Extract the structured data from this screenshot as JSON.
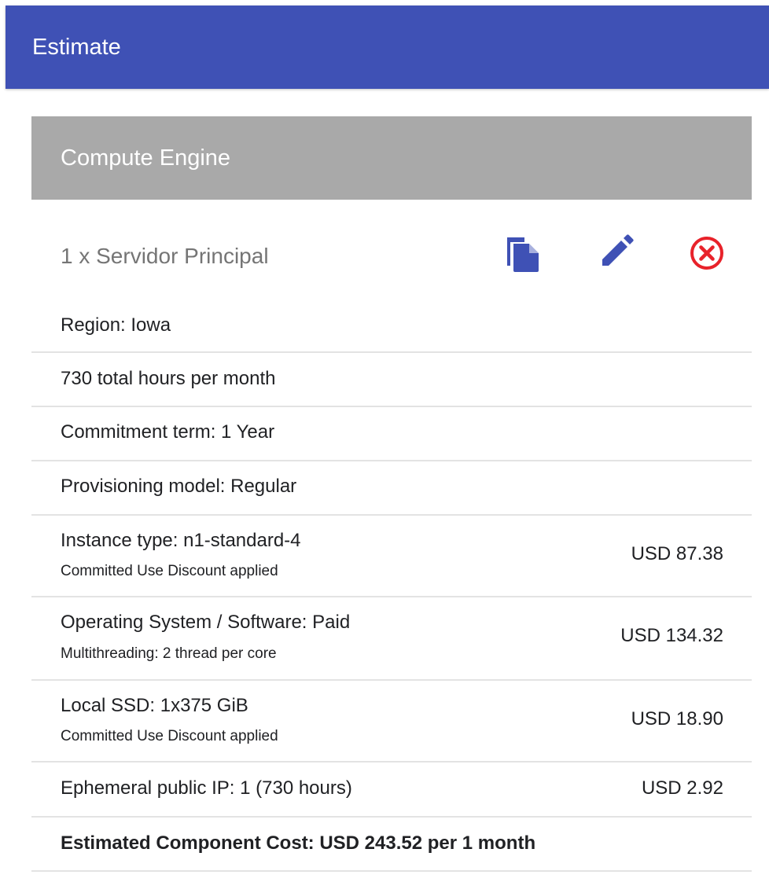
{
  "header": {
    "title": "Estimate",
    "background": "#3f51b5"
  },
  "section": {
    "title": "Compute Engine",
    "background": "#a9a9a9"
  },
  "item": {
    "title": "1 x Servidor Principal",
    "actions": [
      {
        "icon": "copy-icon",
        "color": "#3f51b5"
      },
      {
        "icon": "pencil-icon",
        "color": "#3f51b5"
      },
      {
        "icon": "close-circle-icon",
        "color": "#e8222a"
      }
    ]
  },
  "rows": [
    {
      "main": "Region: Iowa",
      "sub": "",
      "price": ""
    },
    {
      "main": "730 total hours per month",
      "sub": "",
      "price": ""
    },
    {
      "main": "Commitment term: 1 Year",
      "sub": "",
      "price": ""
    },
    {
      "main": "Provisioning model: Regular",
      "sub": "",
      "price": ""
    },
    {
      "main": "Instance type: n1-standard-4",
      "sub": "Committed Use Discount applied",
      "price": "USD 87.38"
    },
    {
      "main": "Operating System / Software: Paid",
      "sub": "Multithreading: 2 thread per core",
      "price": "USD 134.32"
    },
    {
      "main": "Local SSD: 1x375 GiB",
      "sub": "Committed Use Discount applied",
      "price": "USD 18.90"
    },
    {
      "main": "Ephemeral public IP: 1 (730 hours)",
      "sub": "",
      "price": "USD 2.92"
    }
  ],
  "total": {
    "label": "Estimated Component Cost: USD 243.52 per 1 month"
  }
}
